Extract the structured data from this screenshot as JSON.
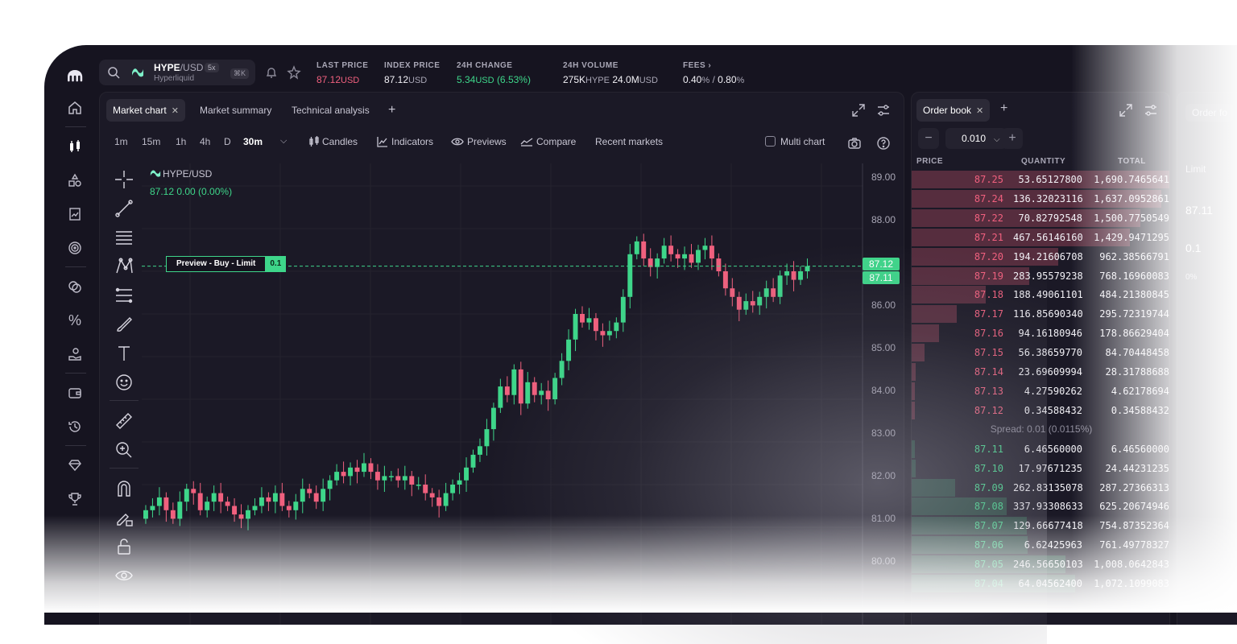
{
  "topbar": {
    "pair_base": "HYPE",
    "pair_quote": "/USD",
    "leverage": "5x",
    "exchange": "Hyperliquid",
    "shortcut": "⌘K",
    "stats": [
      {
        "label": "LAST PRICE",
        "value": "87.12",
        "unit": "USD"
      },
      {
        "label": "INDEX PRICE",
        "value": "87.12",
        "unit": "USD"
      },
      {
        "label": "24H CHANGE",
        "value": "5.34",
        "unit": "USD",
        "extra": "(6.53%)"
      },
      {
        "label": "24H VOLUME",
        "value": "275K",
        "unit": "HYPE",
        "value2": "24.0M",
        "unit2": "USD"
      },
      {
        "label": "FEES",
        "value": "0.40",
        "unit": "%",
        "sep": "/",
        "value2": "0.80",
        "unit2": "%"
      }
    ],
    "fees_chevron": "›"
  },
  "chart": {
    "tabs": [
      "Market chart",
      "Market summary",
      "Technical analysis"
    ],
    "add_tab": "+",
    "timeframes": [
      "1m",
      "15m",
      "1h",
      "4h",
      "D",
      "30m"
    ],
    "selected_timeframe": "30m",
    "tools": {
      "candles": "Candles",
      "indicators": "Indicators",
      "previews": "Previews",
      "compare": "Compare",
      "recent": "Recent markets",
      "multi": "Multi chart"
    },
    "legend_symbol": "HYPE/USD",
    "legend_values": "87.12  0.00 (0.00%)",
    "preview_label": "Preview - Buy - Limit",
    "preview_qty": "0.1",
    "price_tag_1": "87.12",
    "price_tag_2": "87.11",
    "y_ticks": [
      "89.00",
      "88.00",
      "86.00",
      "85.00",
      "84.00",
      "83.00",
      "82.00",
      "81.00",
      "80.00"
    ],
    "colors": {
      "up": "#3ed68a",
      "down": "#f0607e"
    }
  },
  "orderbook": {
    "tab": "Order book",
    "tick_size": "0.010",
    "headers": {
      "price": "PRICE",
      "quantity": "QUANTITY",
      "total": "TOTAL"
    },
    "asks": [
      {
        "p": "87.25",
        "q": "53.65127800",
        "t": "1,690.7465641"
      },
      {
        "p": "87.24",
        "q": "136.32023116",
        "t": "1,637.0952861"
      },
      {
        "p": "87.22",
        "q": "70.82792548",
        "t": "1,500.7750549"
      },
      {
        "p": "87.21",
        "q": "467.56146160",
        "t": "1,429.9471295"
      },
      {
        "p": "87.20",
        "q": "194.21606708",
        "t": "962.38566791"
      },
      {
        "p": "87.19",
        "q": "283.95579238",
        "t": "768.16960083"
      },
      {
        "p": "87.18",
        "q": "188.49061101",
        "t": "484.21380845"
      },
      {
        "p": "87.17",
        "q": "116.85690340",
        "t": "295.72319744"
      },
      {
        "p": "87.16",
        "q": "94.16180946",
        "t": "178.86629404"
      },
      {
        "p": "87.15",
        "q": "56.38659770",
        "t": "84.70448458"
      },
      {
        "p": "87.14",
        "q": "23.69609994",
        "t": "28.31788688"
      },
      {
        "p": "87.13",
        "q": "4.27590262",
        "t": "4.62178694"
      },
      {
        "p": "87.12",
        "q": "0.34588432",
        "t": "0.34588432"
      }
    ],
    "spread": "Spread: 0.01 (0.0115%)",
    "bids": [
      {
        "p": "87.11",
        "q": "6.46560000",
        "t": "6.46560000"
      },
      {
        "p": "87.10",
        "q": "17.97671235",
        "t": "24.44231235"
      },
      {
        "p": "87.09",
        "q": "262.83135078",
        "t": "287.27366313"
      },
      {
        "p": "87.08",
        "q": "337.93308633",
        "t": "625.20674946"
      },
      {
        "p": "87.07",
        "q": "129.66677418",
        "t": "754.87352364"
      },
      {
        "p": "87.06",
        "q": "6.62425963",
        "t": "761.49778327"
      },
      {
        "p": "87.05",
        "q": "246.56650103",
        "t": "1,008.0642843"
      },
      {
        "p": "87.04",
        "q": "64.04562400",
        "t": "1,072.1099083"
      }
    ]
  },
  "order_ticket": {
    "title": "Order fo",
    "limit_tab": "Limit",
    "limit_price": "87.11",
    "qty": "0.1",
    "pct": "0%"
  }
}
